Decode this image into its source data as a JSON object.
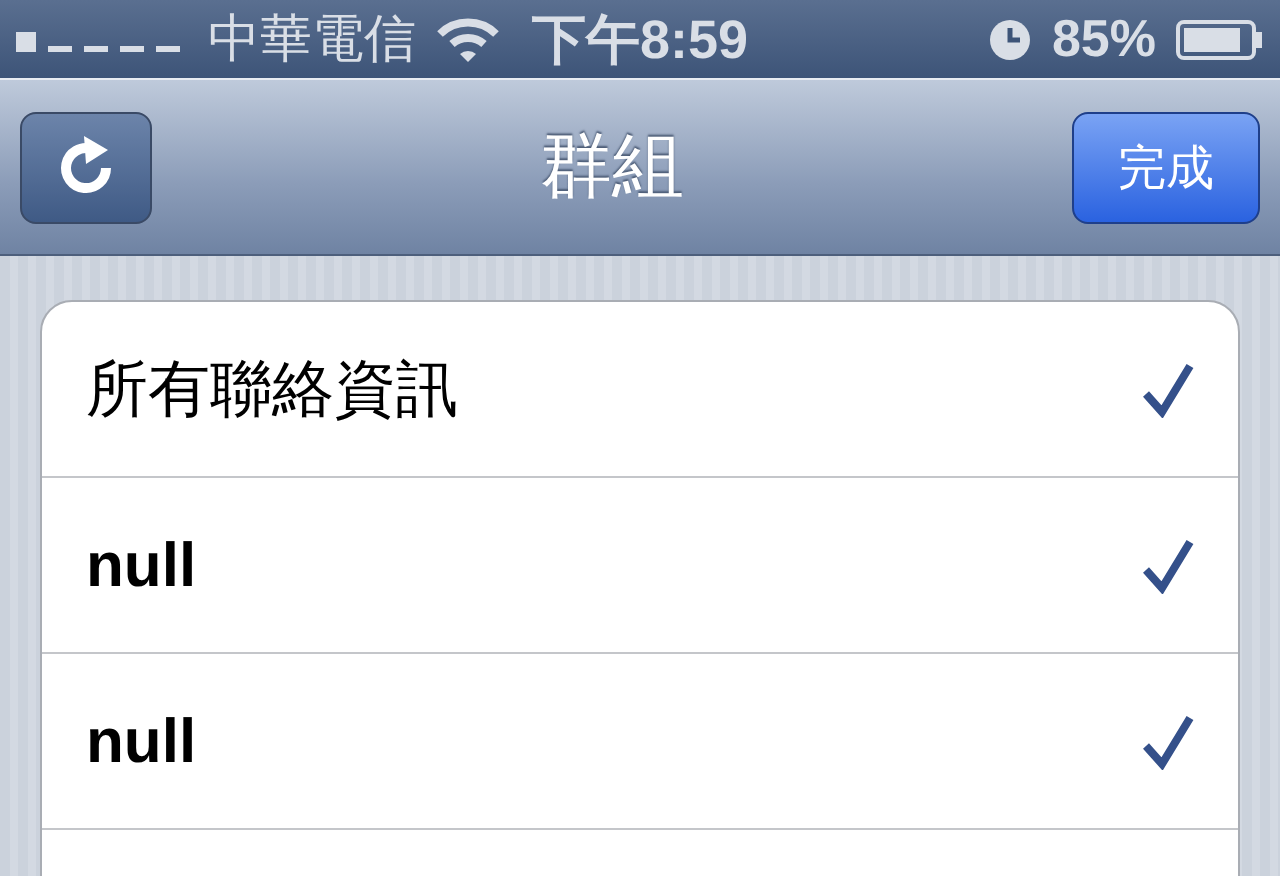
{
  "status_bar": {
    "carrier": "中華電信",
    "time": "下午8:59",
    "battery": "85%"
  },
  "nav_bar": {
    "title": "群組",
    "done_button": "完成"
  },
  "groups": [
    {
      "label": "所有聯絡資訊",
      "checked": true,
      "bold": false
    },
    {
      "label": "null",
      "checked": true,
      "bold": true
    },
    {
      "label": "null",
      "checked": true,
      "bold": true
    }
  ]
}
